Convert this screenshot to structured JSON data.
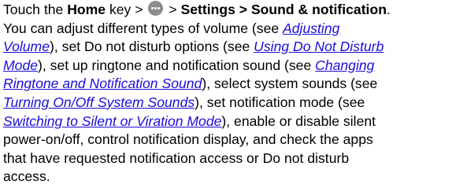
{
  "doc": {
    "l1": {
      "a": "Touch the ",
      "home": "Home",
      "b": " key > ",
      "c": " > ",
      "settings": "Settings",
      "d": " > ",
      "sound": "Sound & notification",
      "e": "."
    },
    "l2": {
      "a": "You can adjust different types of volume (see ",
      "link": "Adjusting"
    },
    "l3": {
      "link": "Volume",
      "a": "), set Do not disturb options (see ",
      "link2": "Using Do Not Disturb"
    },
    "l4": {
      "link": "Mode",
      "a": "), set up ringtone and notification sound (see ",
      "link2": "Changing"
    },
    "l5": {
      "link": "Ringtone and Notification Sound",
      "a": "), select system sounds (see"
    },
    "l6": {
      "link": "Turning On/Off System Sounds",
      "a": "), set notification mode (see"
    },
    "l7": {
      "link": "Switching to Silent or Viration Mode",
      "a": "), enable or disable silent"
    },
    "l8": "power-on/off, control notification display, and check the apps",
    "l9": "that have requested notification access or Do not disturb",
    "l10": "access.",
    "icons": {
      "apps_button": "apps-grid-icon"
    },
    "colors": {
      "link": "#1a0dd6",
      "icon": "#8c8c8c",
      "text": "#000000"
    }
  }
}
